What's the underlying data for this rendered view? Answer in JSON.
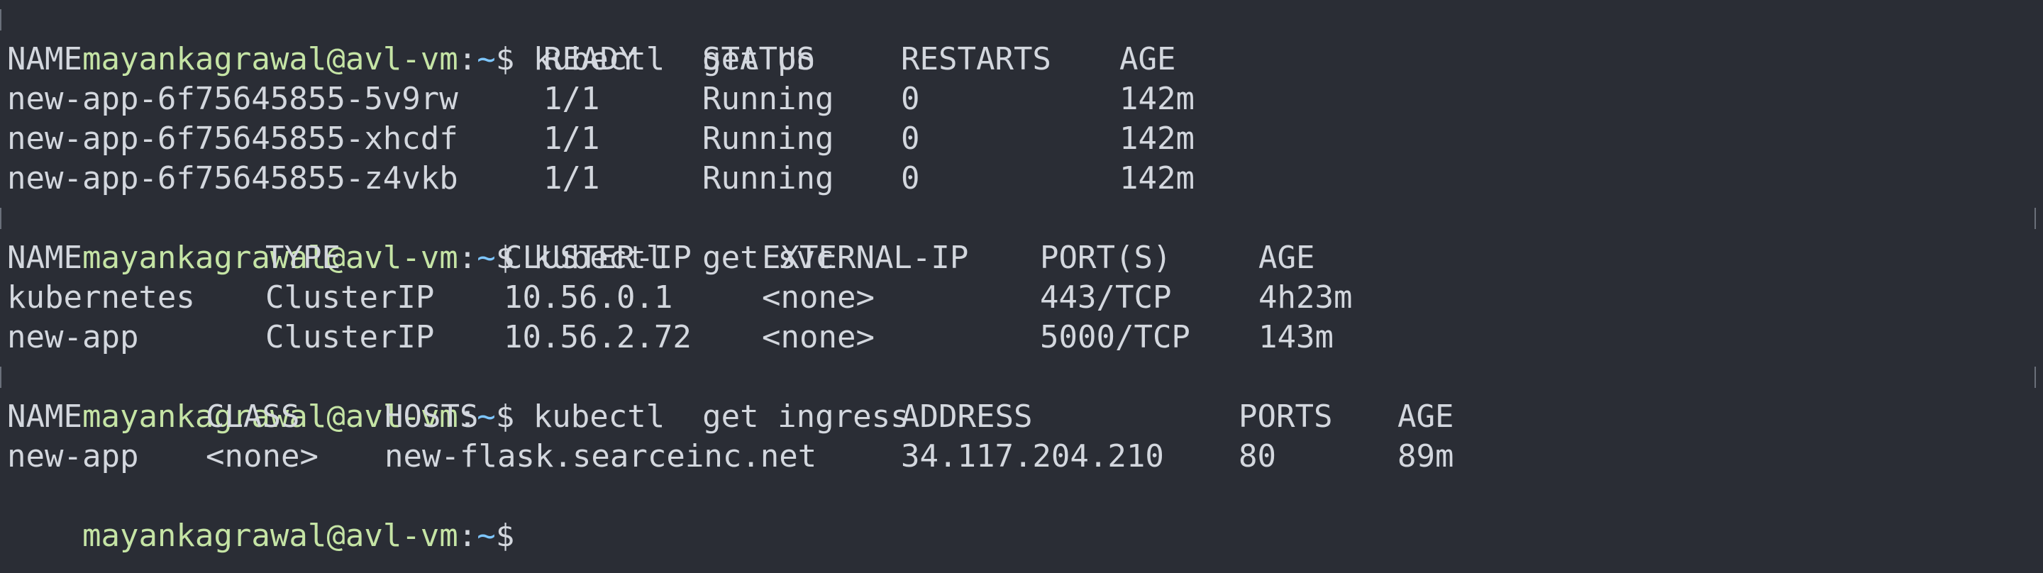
{
  "prompt": {
    "user_host": "mayankagrawal@avl-vm",
    "colon": ":",
    "path": "~",
    "dollar": "$"
  },
  "commands": {
    "po": " kubectl  get po",
    "svc": " kubectl  get svc",
    "ingress": " kubectl  get ingress"
  },
  "pods": {
    "headers": [
      "NAME",
      "READY",
      "STATUS",
      "RESTARTS",
      "AGE"
    ],
    "rows": [
      [
        "new-app-6f75645855-5v9rw",
        "1/1",
        "Running",
        "0",
        "142m"
      ],
      [
        "new-app-6f75645855-xhcdf",
        "1/1",
        "Running",
        "0",
        "142m"
      ],
      [
        "new-app-6f75645855-z4vkb",
        "1/1",
        "Running",
        "0",
        "142m"
      ]
    ]
  },
  "services": {
    "headers": [
      "NAME",
      "TYPE",
      "CLUSTER-IP",
      "EXTERNAL-IP",
      "PORT(S)",
      "AGE"
    ],
    "rows": [
      [
        "kubernetes",
        "ClusterIP",
        "10.56.0.1",
        "<none>",
        "443/TCP",
        "4h23m"
      ],
      [
        "new-app",
        "ClusterIP",
        "10.56.2.72",
        "<none>",
        "5000/TCP",
        "143m"
      ]
    ]
  },
  "ingress": {
    "headers": [
      "NAME",
      "CLASS",
      "HOSTS",
      "ADDRESS",
      "PORTS",
      "AGE"
    ],
    "rows": [
      [
        "new-app",
        "<none>",
        "new-flask.searceinc.net",
        "34.117.204.210",
        "80",
        "89m"
      ]
    ]
  },
  "colors": {
    "background": "#2a2d35",
    "text": "#d3d7de",
    "prompt_user": "#c5e4a5",
    "prompt_path": "#7ec6ff"
  }
}
